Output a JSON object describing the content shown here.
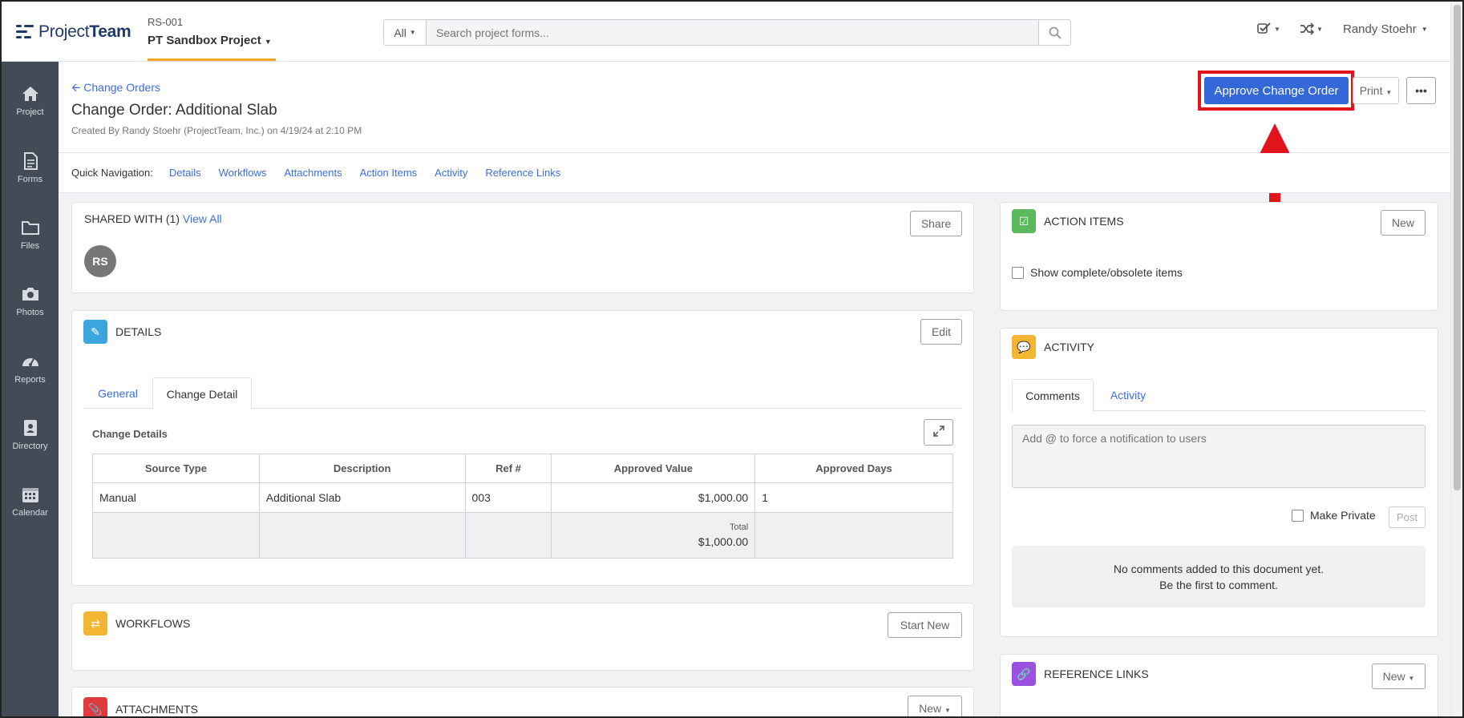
{
  "logo": {
    "text_light": "Project",
    "text_bold": "Team"
  },
  "project": {
    "code": "RS-001",
    "name": "PT Sandbox Project"
  },
  "search": {
    "scope": "All",
    "placeholder": "Search project forms..."
  },
  "user": {
    "name": "Randy Stoehr"
  },
  "sidebar": {
    "items": [
      {
        "label": "Project",
        "icon": "home-icon"
      },
      {
        "label": "Forms",
        "icon": "document-icon"
      },
      {
        "label": "Files",
        "icon": "folder-icon"
      },
      {
        "label": "Photos",
        "icon": "camera-icon"
      },
      {
        "label": "Reports",
        "icon": "gauge-icon"
      },
      {
        "label": "Directory",
        "icon": "contact-book-icon"
      },
      {
        "label": "Calendar",
        "icon": "calendar-icon"
      }
    ]
  },
  "header": {
    "back_link": "Change Orders",
    "title": "Change Order: Additional Slab",
    "subtitle": "Created By Randy Stoehr (ProjectTeam, Inc.) on 4/19/24 at 2:10 PM",
    "approve_label": "Approve Change Order",
    "print_label": "Print",
    "more_label": "•••"
  },
  "quicknav": {
    "label": "Quick Navigation:",
    "links": [
      "Details",
      "Workflows",
      "Attachments",
      "Action Items",
      "Activity",
      "Reference Links"
    ]
  },
  "shared": {
    "title": "SHARED WITH (1)",
    "view_all": "View All",
    "share_label": "Share",
    "avatar_initials": "RS"
  },
  "details": {
    "title": "DETAILS",
    "edit_label": "Edit",
    "tabs": [
      "General",
      "Change Detail"
    ],
    "section_title": "Change Details",
    "columns": [
      "Source Type",
      "Description",
      "Ref #",
      "Approved Value",
      "Approved Days"
    ],
    "rows": [
      [
        "Manual",
        "Additional Slab",
        "003",
        "$1,000.00",
        "1"
      ]
    ],
    "total_label": "Total",
    "total_value": "$1,000.00"
  },
  "workflows": {
    "title": "WORKFLOWS",
    "start_label": "Start New"
  },
  "attachments": {
    "title": "ATTACHMENTS",
    "new_label": "New"
  },
  "action_items": {
    "title": "ACTION ITEMS",
    "new_label": "New",
    "checkbox_label": "Show complete/obsolete items"
  },
  "activity": {
    "title": "ACTIVITY",
    "tabs": [
      "Comments",
      "Activity"
    ],
    "comment_placeholder": "Add @ to force a notification to users",
    "private_label": "Make Private",
    "post_label": "Post",
    "empty_line1": "No comments added to this document yet.",
    "empty_line2": "Be the first to comment."
  },
  "reference_links": {
    "title": "REFERENCE LINKS",
    "new_label": "New"
  },
  "colors": {
    "accent": "#3468d9",
    "highlight": "#e1141b",
    "sidebar": "#434b57",
    "project_underline": "#f5a623"
  }
}
